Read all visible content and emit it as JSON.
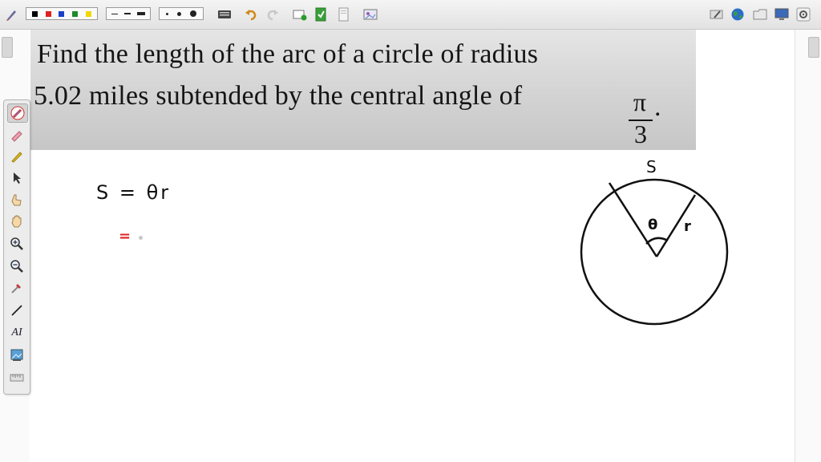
{
  "toolbar": {
    "colors": [
      "#000000",
      "#e02020",
      "#1c3fc8",
      "#1e8a2a",
      "#f2d800"
    ],
    "tools": [
      "pen-tool-icon",
      "color-palette",
      "line-style-palette",
      "pen-size-palette",
      "keyboard-icon",
      "undo-icon",
      "redo-icon",
      "new-page-icon",
      "insert-page-icon",
      "blank-page-icon",
      "gallery-icon",
      "eraser-page-icon",
      "globe-icon",
      "folder-icon",
      "screen-icon",
      "settings-icon"
    ]
  },
  "side_tools": [
    "pen-icon",
    "highlighter-icon",
    "marker-icon",
    "pointer-icon",
    "hand-pointer-icon",
    "hand-icon",
    "zoom-in-icon",
    "zoom-out-icon",
    "dropper-icon",
    "line-icon",
    "text-tool-icon",
    "image-tool-icon",
    "ruler-icon"
  ],
  "text_tool_label": "AI",
  "problem": {
    "line1": "Find the length of the arc of a circle of radius",
    "line2": "5.02 miles subtended by the central angle of",
    "numerator": "π",
    "denominator": "3",
    "period": "."
  },
  "work": {
    "formula": "S = θr",
    "equals": "="
  },
  "diagram": {
    "arc_label": "S",
    "angle_label": "θ",
    "radius_label": "r"
  }
}
